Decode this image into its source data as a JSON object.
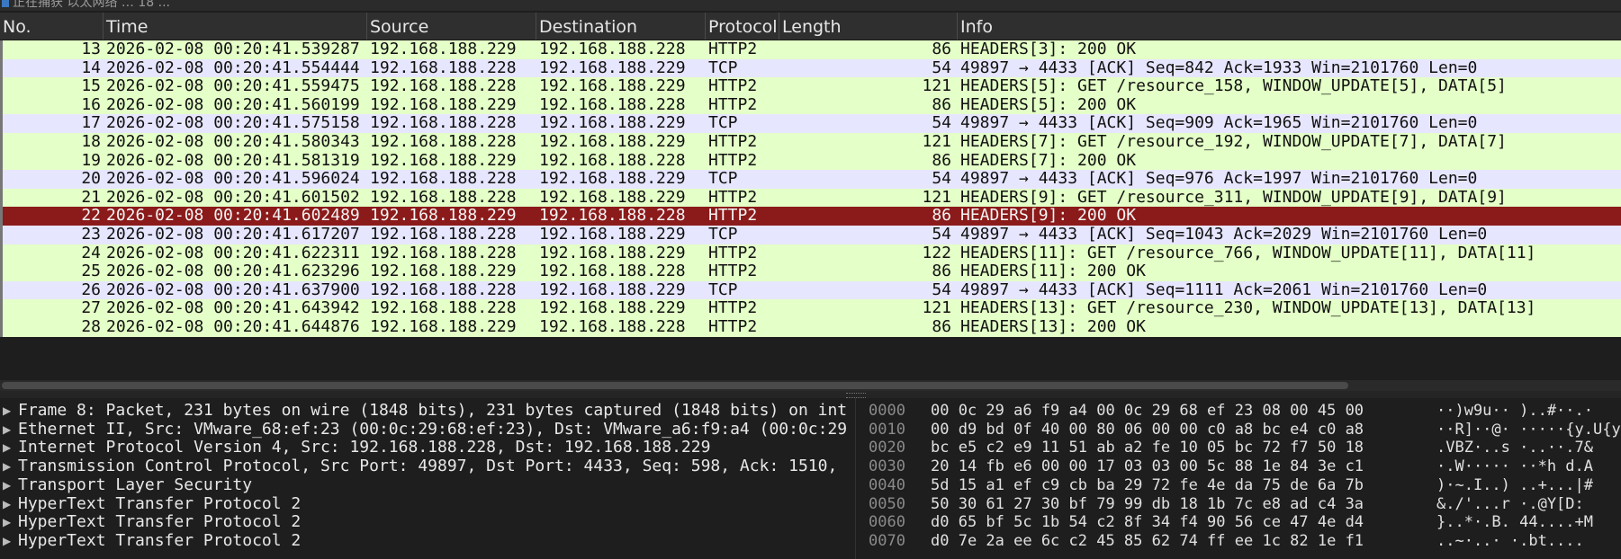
{
  "window": {
    "title": "正在捕获 以太网络 … 18 ..."
  },
  "columns": [
    {
      "key": "no",
      "label": "No."
    },
    {
      "key": "time",
      "label": "Time"
    },
    {
      "key": "source",
      "label": "Source"
    },
    {
      "key": "destination",
      "label": "Destination"
    },
    {
      "key": "protocol",
      "label": "Protocol"
    },
    {
      "key": "length",
      "label": "Length"
    },
    {
      "key": "info",
      "label": "Info"
    }
  ],
  "packets": [
    {
      "no": "13",
      "time": "2026-02-08 00:20:41.539287",
      "src": "192.168.188.229",
      "dst": "192.168.188.228",
      "proto": "HTTP2",
      "len": "86",
      "info": "HEADERS[3]: 200 OK"
    },
    {
      "no": "14",
      "time": "2026-02-08 00:20:41.554444",
      "src": "192.168.188.228",
      "dst": "192.168.188.229",
      "proto": "TCP",
      "len": "54",
      "info": "49897 → 4433 [ACK] Seq=842 Ack=1933 Win=2101760 Len=0"
    },
    {
      "no": "15",
      "time": "2026-02-08 00:20:41.559475",
      "src": "192.168.188.228",
      "dst": "192.168.188.229",
      "proto": "HTTP2",
      "len": "121",
      "info": "HEADERS[5]: GET /resource_158, WINDOW_UPDATE[5], DATA[5]"
    },
    {
      "no": "16",
      "time": "2026-02-08 00:20:41.560199",
      "src": "192.168.188.229",
      "dst": "192.168.188.228",
      "proto": "HTTP2",
      "len": "86",
      "info": "HEADERS[5]: 200 OK"
    },
    {
      "no": "17",
      "time": "2026-02-08 00:20:41.575158",
      "src": "192.168.188.228",
      "dst": "192.168.188.229",
      "proto": "TCP",
      "len": "54",
      "info": "49897 → 4433 [ACK] Seq=909 Ack=1965 Win=2101760 Len=0"
    },
    {
      "no": "18",
      "time": "2026-02-08 00:20:41.580343",
      "src": "192.168.188.228",
      "dst": "192.168.188.229",
      "proto": "HTTP2",
      "len": "121",
      "info": "HEADERS[7]: GET /resource_192, WINDOW_UPDATE[7], DATA[7]"
    },
    {
      "no": "19",
      "time": "2026-02-08 00:20:41.581319",
      "src": "192.168.188.229",
      "dst": "192.168.188.228",
      "proto": "HTTP2",
      "len": "86",
      "info": "HEADERS[7]: 200 OK"
    },
    {
      "no": "20",
      "time": "2026-02-08 00:20:41.596024",
      "src": "192.168.188.228",
      "dst": "192.168.188.229",
      "proto": "TCP",
      "len": "54",
      "info": "49897 → 4433 [ACK] Seq=976 Ack=1997 Win=2101760 Len=0"
    },
    {
      "no": "21",
      "time": "2026-02-08 00:20:41.601502",
      "src": "192.168.188.228",
      "dst": "192.168.188.229",
      "proto": "HTTP2",
      "len": "121",
      "info": "HEADERS[9]: GET /resource_311, WINDOW_UPDATE[9], DATA[9]"
    },
    {
      "no": "22",
      "time": "2026-02-08 00:20:41.602489",
      "src": "192.168.188.229",
      "dst": "192.168.188.228",
      "proto": "HTTP2",
      "len": "86",
      "info": "HEADERS[9]: 200 OK",
      "selected": true
    },
    {
      "no": "23",
      "time": "2026-02-08 00:20:41.617207",
      "src": "192.168.188.228",
      "dst": "192.168.188.229",
      "proto": "TCP",
      "len": "54",
      "info": "49897 → 4433 [ACK] Seq=1043 Ack=2029 Win=2101760 Len=0"
    },
    {
      "no": "24",
      "time": "2026-02-08 00:20:41.622311",
      "src": "192.168.188.228",
      "dst": "192.168.188.229",
      "proto": "HTTP2",
      "len": "122",
      "info": "HEADERS[11]: GET /resource_766, WINDOW_UPDATE[11], DATA[11]"
    },
    {
      "no": "25",
      "time": "2026-02-08 00:20:41.623296",
      "src": "192.168.188.229",
      "dst": "192.168.188.228",
      "proto": "HTTP2",
      "len": "86",
      "info": "HEADERS[11]: 200 OK"
    },
    {
      "no": "26",
      "time": "2026-02-08 00:20:41.637900",
      "src": "192.168.188.228",
      "dst": "192.168.188.229",
      "proto": "TCP",
      "len": "54",
      "info": "49897 → 4433 [ACK] Seq=1111 Ack=2061 Win=2101760 Len=0"
    },
    {
      "no": "27",
      "time": "2026-02-08 00:20:41.643942",
      "src": "192.168.188.228",
      "dst": "192.168.188.229",
      "proto": "HTTP2",
      "len": "121",
      "info": "HEADERS[13]: GET /resource_230, WINDOW_UPDATE[13], DATA[13]"
    },
    {
      "no": "28",
      "time": "2026-02-08 00:20:41.644876",
      "src": "192.168.188.229",
      "dst": "192.168.188.228",
      "proto": "HTTP2",
      "len": "86",
      "info": "HEADERS[13]: 200 OK"
    }
  ],
  "details": [
    "Frame 8: Packet, 231 bytes on wire (1848 bits), 231 bytes captured (1848 bits) on int",
    "Ethernet II, Src: VMware_68:ef:23 (00:0c:29:68:ef:23), Dst: VMware_a6:f9:a4 (00:0c:29",
    "Internet Protocol Version 4, Src: 192.168.188.228, Dst: 192.168.188.229",
    "Transmission Control Protocol, Src Port: 49897, Dst Port: 4433, Seq: 598, Ack: 1510,",
    "Transport Layer Security",
    "HyperText Transfer Protocol 2",
    "HyperText Transfer Protocol 2",
    "HyperText Transfer Protocol 2"
  ],
  "bytes": [
    {
      "offset": "0000",
      "hex": "00 0c 29 a6 f9 a4 00 0c  29 68 ef 23 08 00 45 00",
      "ascii": "··)w9u·· )..#··.·"
    },
    {
      "offset": "0010",
      "hex": "00 d9 bd 0f 40 00 80 06  00 00 c0 a8 bc e4 c0 a8",
      "ascii": "··R]··@·  ·····{y.U{y"
    },
    {
      "offset": "0020",
      "hex": "bc e5 c2 e9 11 51 ab a2  fe 10 05 bc 72 f7 50 18",
      "ascii": ".VBZ·..s ·..··.7&"
    },
    {
      "offset": "0030",
      "hex": "20 14 fb e6 00 00 17 03  03 00 5c 88 1e 84 3e c1",
      "ascii": " ·.W····· ··*h d.A"
    },
    {
      "offset": "0040",
      "hex": "5d 15 a1 ef c9 cb ba 29  72 fe 4e da 75 de 6a 7b",
      "ascii": ")·~.I..)  ..+...|#"
    },
    {
      "offset": "0050",
      "hex": "50 30 61 27 30 bf 79 99  db 18 1b 7c e8 ad c4 3a",
      "ascii": "&./'...r ·.@Y[D:"
    },
    {
      "offset": "0060",
      "hex": "d0 65 bf 5c 1b 54 c2 8f  34 f4 90 56 ce 47 4e d4",
      "ascii": "}..*·.B. 44....+M"
    },
    {
      "offset": "0070",
      "hex": "d0 7e 2a ee 6c c2 45 85  62 74 ff ee 1c 82 1e f1",
      "ascii": "..~·..·  ·.bt...."
    }
  ],
  "colors": {
    "http2_row": "#e4ffc7",
    "tcp_row": "#e7e6ff",
    "selected_row": "#8b1a1a",
    "pane_bg": "#1e1e1e"
  }
}
